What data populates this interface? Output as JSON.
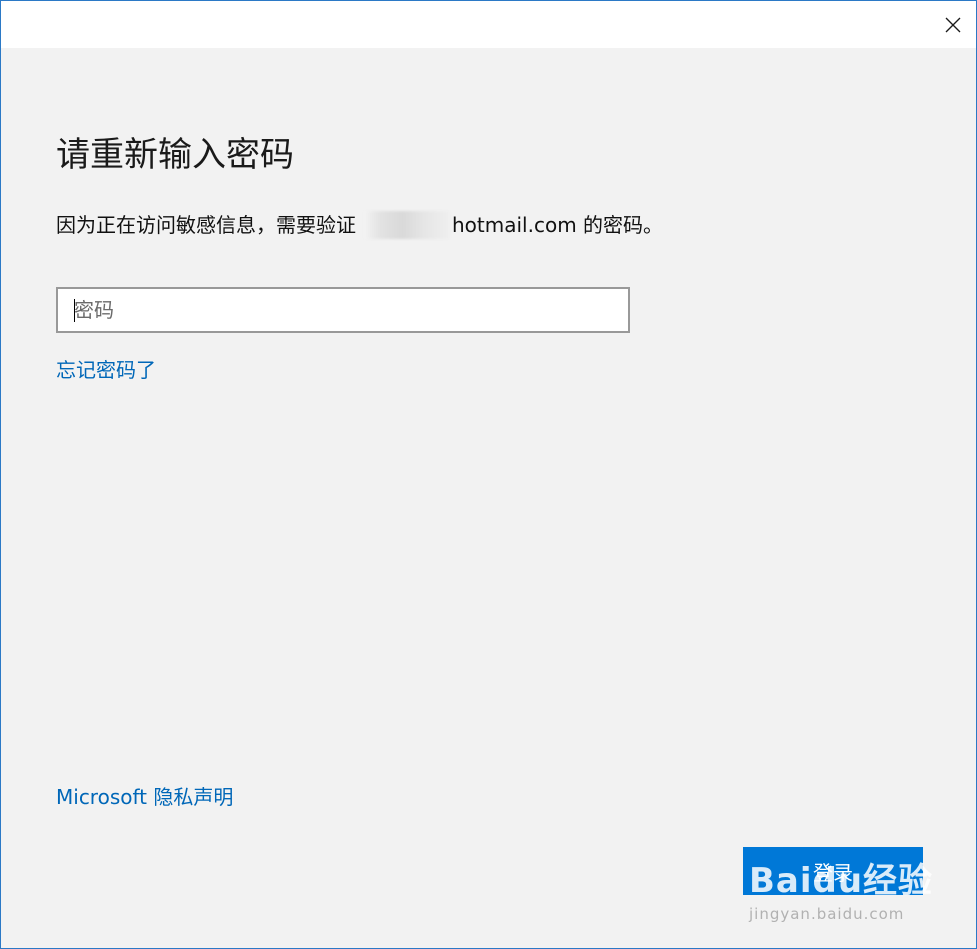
{
  "dialog": {
    "close_icon": "close-icon",
    "heading": "请重新输入密码",
    "description_prefix": "因为正在访问敏感信息，需要验证",
    "description_email_suffix": "hotmail.com 的密码。",
    "password_placeholder": "密码",
    "forgot_link": "忘记密码了",
    "privacy_link": "Microsoft 隐私声明",
    "signin_button": "登录",
    "accent_color": "#0078d7",
    "link_color": "#0067b8"
  },
  "watermark": {
    "logo_text": "Baidu经验",
    "url": "jingyan.baidu.com"
  }
}
